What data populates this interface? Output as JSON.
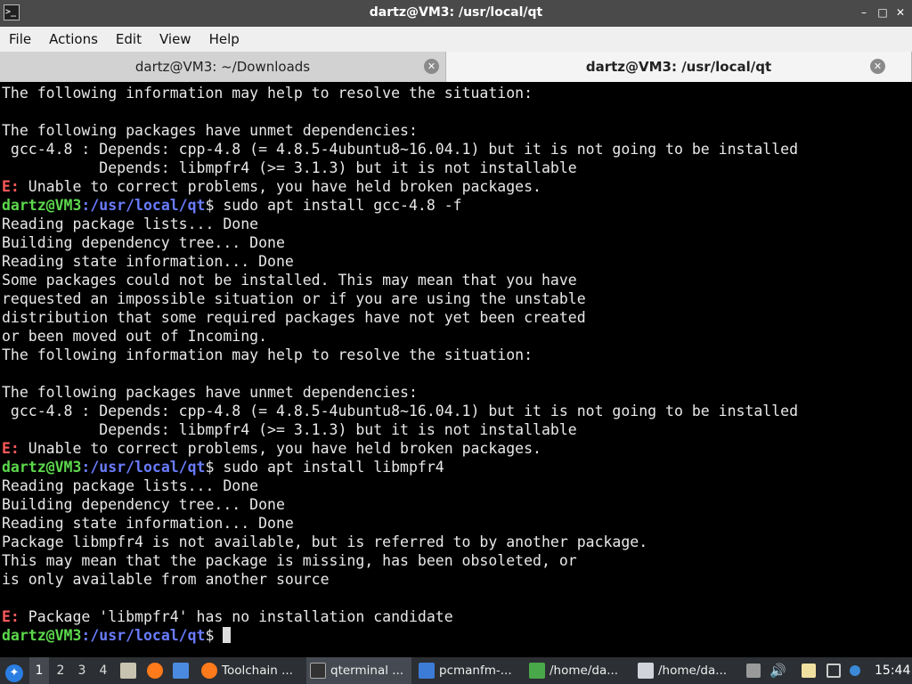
{
  "window": {
    "title": "dartz@VM3: /usr/local/qt",
    "app_icon": ">_",
    "buttons": {
      "minimize": "–",
      "maximize": "□",
      "close": "✕"
    }
  },
  "menubar": [
    "File",
    "Actions",
    "Edit",
    "View",
    "Help"
  ],
  "tabs": [
    {
      "label": "dartz@VM3: ~/Downloads",
      "active": false
    },
    {
      "label": "dartz@VM3: /usr/local/qt",
      "active": true
    }
  ],
  "tab_close_glyph": "✕",
  "colors": {
    "prompt_user": "#5cd84c",
    "prompt_path": "#6a7cff",
    "error_prefix": "#ff5a5a",
    "terminal_bg": "#000000",
    "terminal_fg": "#e8e8e8"
  },
  "terminal": {
    "prompt": {
      "user": "dartz@VM3",
      "sep": ":",
      "path": "/usr/local/qt",
      "dollar": "$"
    },
    "lines": [
      {
        "t": "text",
        "s": "The following information may help to resolve the situation:"
      },
      {
        "t": "text",
        "s": ""
      },
      {
        "t": "text",
        "s": "The following packages have unmet dependencies:"
      },
      {
        "t": "text",
        "s": " gcc-4.8 : Depends: cpp-4.8 (= 4.8.5-4ubuntu8~16.04.1) but it is not going to be installed"
      },
      {
        "t": "text",
        "s": "           Depends: libmpfr4 (>= 3.1.3) but it is not installable"
      },
      {
        "t": "error",
        "p": "E:",
        "s": " Unable to correct problems, you have held broken packages."
      },
      {
        "t": "prompt",
        "s": " sudo apt install gcc-4.8 -f"
      },
      {
        "t": "text",
        "s": "Reading package lists... Done"
      },
      {
        "t": "text",
        "s": "Building dependency tree... Done"
      },
      {
        "t": "text",
        "s": "Reading state information... Done"
      },
      {
        "t": "text",
        "s": "Some packages could not be installed. This may mean that you have"
      },
      {
        "t": "text",
        "s": "requested an impossible situation or if you are using the unstable"
      },
      {
        "t": "text",
        "s": "distribution that some required packages have not yet been created"
      },
      {
        "t": "text",
        "s": "or been moved out of Incoming."
      },
      {
        "t": "text",
        "s": "The following information may help to resolve the situation:"
      },
      {
        "t": "text",
        "s": ""
      },
      {
        "t": "text",
        "s": "The following packages have unmet dependencies:"
      },
      {
        "t": "text",
        "s": " gcc-4.8 : Depends: cpp-4.8 (= 4.8.5-4ubuntu8~16.04.1) but it is not going to be installed"
      },
      {
        "t": "text",
        "s": "           Depends: libmpfr4 (>= 3.1.3) but it is not installable"
      },
      {
        "t": "error",
        "p": "E:",
        "s": " Unable to correct problems, you have held broken packages."
      },
      {
        "t": "prompt",
        "s": " sudo apt install libmpfr4"
      },
      {
        "t": "text",
        "s": "Reading package lists... Done"
      },
      {
        "t": "text",
        "s": "Building dependency tree... Done"
      },
      {
        "t": "text",
        "s": "Reading state information... Done"
      },
      {
        "t": "text",
        "s": "Package libmpfr4 is not available, but is referred to by another package."
      },
      {
        "t": "text",
        "s": "This may mean that the package is missing, has been obsoleted, or"
      },
      {
        "t": "text",
        "s": "is only available from another source"
      },
      {
        "t": "text",
        "s": ""
      },
      {
        "t": "error",
        "p": "E:",
        "s": " Package 'libmpfr4' has no installation candidate"
      },
      {
        "t": "prompt",
        "s": " ",
        "cursor": true
      }
    ]
  },
  "taskbar": {
    "workspaces": [
      "1",
      "2",
      "3",
      "4"
    ],
    "current_workspace": "1",
    "tasks": [
      {
        "label": "Toolchain ...",
        "icon": "firefox-icon",
        "color": "#ff7a1a"
      },
      {
        "label": "qterminal ...",
        "icon": "terminal-icon",
        "color": "#333333",
        "active": true
      },
      {
        "label": "pcmanfm-...",
        "icon": "folder-icon",
        "color": "#3d7cd6"
      },
      {
        "label": "/home/da...",
        "icon": "text-editor-icon",
        "color": "#49a84a"
      },
      {
        "label": "/home/da...",
        "icon": "featherpad-icon",
        "color": "#d0d4da"
      }
    ],
    "clock": "15:44"
  }
}
